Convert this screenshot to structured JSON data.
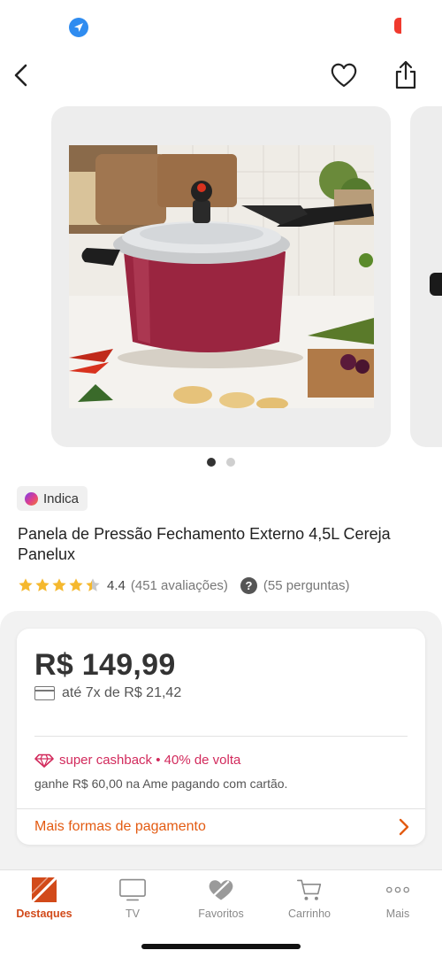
{
  "status_bar": {
    "location_icon": "location-arrow-icon",
    "battery_icon": "battery-icon",
    "battery_color": "#f03a2e"
  },
  "nav": {
    "back_icon": "chevron-left-icon",
    "favorite_icon": "heart-outline-icon",
    "share_icon": "share-icon"
  },
  "carousel": {
    "image_alt": "product-photo-pressure-cooker",
    "slide_count": 2,
    "active_index": 0
  },
  "product": {
    "badge": "Indica",
    "title": "Panela de Pressão Fechamento Externo 4,5L Cereja Panelux",
    "rating": 4.4,
    "rating_text": "4.4",
    "reviews": "(451 avaliações)",
    "questions": "(55 perguntas)"
  },
  "pricing": {
    "price": "R$ 149,99",
    "installments": "até 7x de R$ 21,42",
    "cashback": "super cashback • 40% de volta",
    "ame_text": "ganhe R$ 60,00 na Ame pagando com cartão.",
    "more_payment": "Mais formas de pagamento"
  },
  "tab_bar": {
    "active": "Destaques",
    "items": [
      {
        "label": "Destaques",
        "icon": "highlights-icon"
      },
      {
        "label": "TV",
        "icon": "tv-icon"
      },
      {
        "label": "Favoritos",
        "icon": "heart-icon"
      },
      {
        "label": "Carrinho",
        "icon": "cart-icon"
      },
      {
        "label": "Mais",
        "icon": "more-dots-icon"
      }
    ]
  },
  "colors": {
    "accent": "#e35b12",
    "cashback": "#d22a5c",
    "star": "#f5b82e"
  }
}
